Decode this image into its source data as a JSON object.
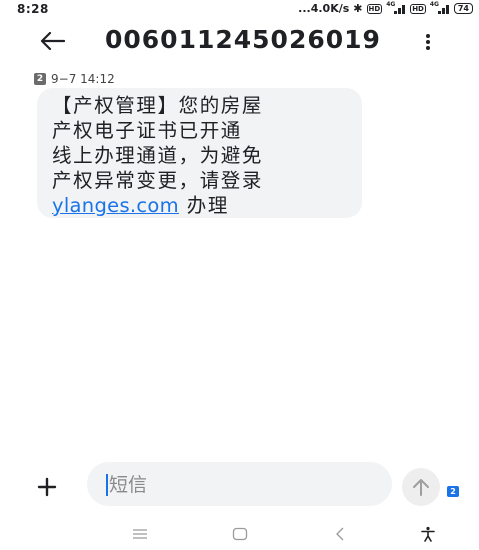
{
  "status_bar": {
    "time": "8:28",
    "network_speed": "...4.0K/s",
    "battery_level": "74",
    "hd_label": "HD",
    "network_type": "4G"
  },
  "header": {
    "title": "006011245026019",
    "back_icon": "arrow-left-icon",
    "more_icon": "more-vert-icon"
  },
  "message": {
    "sim_slot": "2",
    "timestamp": "9−7 14:12",
    "lines": [
      "【产权管理】您的房屋",
      "产权电子证书已开通",
      "线上办理通道，为避免",
      "产权异常变更，请登录"
    ],
    "link_text": "ylanges.com",
    "link_suffix": " 办理"
  },
  "compose": {
    "placeholder": "短信",
    "sim_slot": "2",
    "plus_icon": "plus-icon",
    "send_icon": "arrow-up-icon"
  },
  "nav_bar": {
    "icons": [
      "menu-icon",
      "home-icon",
      "back-icon",
      "accessibility-icon"
    ]
  },
  "colors": {
    "accent": "#1a73e8",
    "bubble": "#f1f3f4",
    "text": "#202124"
  }
}
